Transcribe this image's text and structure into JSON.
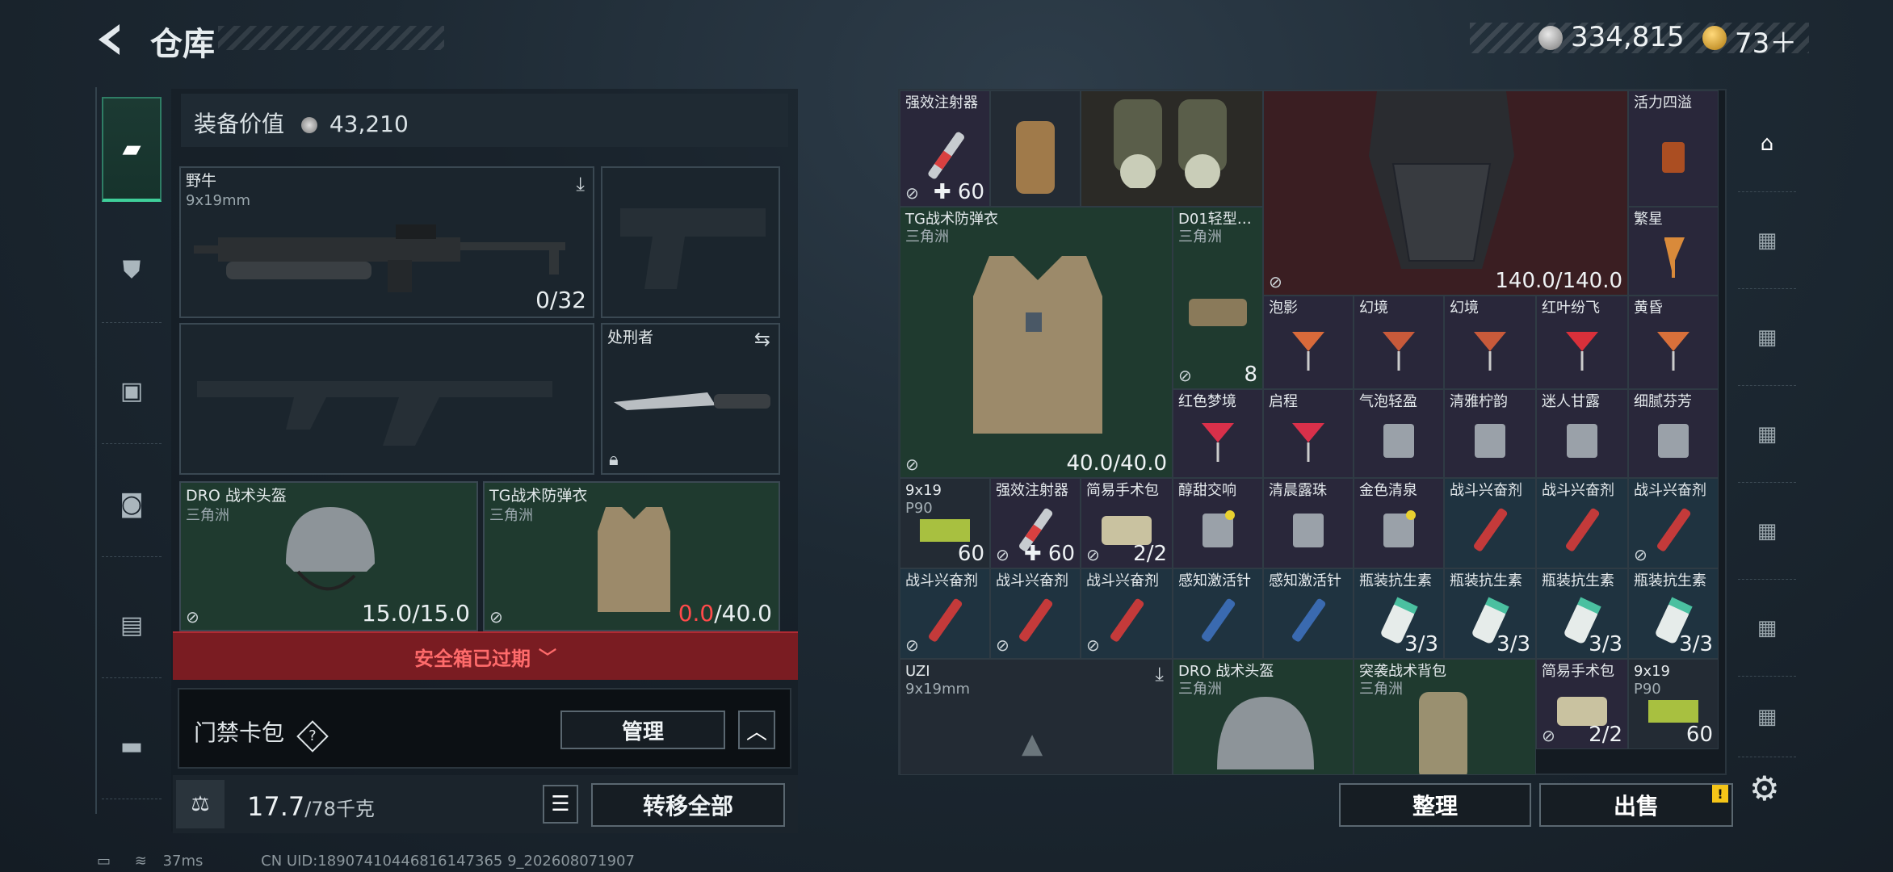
{
  "header": {
    "title": "仓库",
    "currency_1": "334,815",
    "currency_2": "73＋"
  },
  "left_panel": {
    "equip_value_label": "装备价值",
    "equip_value": "43,210",
    "primary_weapon": {
      "name": "野牛",
      "caliber": "9x19mm",
      "ammo": "0/32"
    },
    "melee": {
      "name": "处刑者"
    },
    "helmet": {
      "name": "DRO 战术头盔",
      "map": "三角洲",
      "durability": "15.0/15.0"
    },
    "armor": {
      "name": "TG战术防弹衣",
      "map": "三角洲",
      "durability_current": "0.0",
      "durability_max": "/40.0"
    },
    "safe_box_status": "安全箱已过期",
    "keycard_label": "门禁卡包",
    "manage_label": "管理",
    "weight_current": "17.7",
    "weight_max": "/78千克",
    "transfer_all_label": "转移全部"
  },
  "storage": {
    "items": [
      {
        "name": "强效注射器",
        "qty": "✚ 60"
      },
      {
        "name": "活力四溢"
      },
      {
        "name": "TG战术防弹衣",
        "map": "三角洲",
        "durability": "40.0/40.0"
      },
      {
        "name": "D01轻型…",
        "map": "三角洲",
        "qty": "8"
      },
      {
        "name": "繁星"
      },
      {
        "durability": "140.0/140.0"
      },
      {
        "name": "泡影"
      },
      {
        "name": "幻境"
      },
      {
        "name": "幻境"
      },
      {
        "name": "红叶纷飞"
      },
      {
        "name": "黄昏"
      },
      {
        "name": "红色梦境"
      },
      {
        "name": "启程"
      },
      {
        "name": "气泡轻盈"
      },
      {
        "name": "清雅柠韵"
      },
      {
        "name": "迷人甘露"
      },
      {
        "name": "细腻芬芳"
      },
      {
        "name": "9x19",
        "sub": "P90",
        "qty": "60"
      },
      {
        "name": "强效注射器",
        "qty": "✚ 60"
      },
      {
        "name": "简易手术包",
        "qty": "2/2"
      },
      {
        "name": "醇甜交响"
      },
      {
        "name": "清晨露珠"
      },
      {
        "name": "金色清泉"
      },
      {
        "name": "战斗兴奋剂"
      },
      {
        "name": "战斗兴奋剂"
      },
      {
        "name": "战斗兴奋剂"
      },
      {
        "name": "战斗兴奋剂"
      },
      {
        "name": "战斗兴奋剂"
      },
      {
        "name": "战斗兴奋剂"
      },
      {
        "name": "感知激活针"
      },
      {
        "name": "感知激活针"
      },
      {
        "name": "瓶装抗生素",
        "qty": "3/3"
      },
      {
        "name": "瓶装抗生素",
        "qty": "3/3"
      },
      {
        "name": "瓶装抗生素",
        "qty": "3/3"
      },
      {
        "name": "瓶装抗生素",
        "qty": "3/3"
      },
      {
        "name": "UZI",
        "sub": "9x19mm"
      },
      {
        "name": "DRO 战术头盔",
        "map": "三角洲"
      },
      {
        "name": "突袭战术背包",
        "map": "三角洲"
      },
      {
        "name": "简易手术包",
        "qty": "2/2"
      },
      {
        "name": "9x19",
        "sub": "P90",
        "qty": "60"
      }
    ],
    "sort_label": "整理",
    "sell_label": "出售",
    "sell_badge": "!"
  },
  "status_bar": {
    "ping": "37ms",
    "uid": "CN UID:18907410446816147365 9_202608071907"
  }
}
